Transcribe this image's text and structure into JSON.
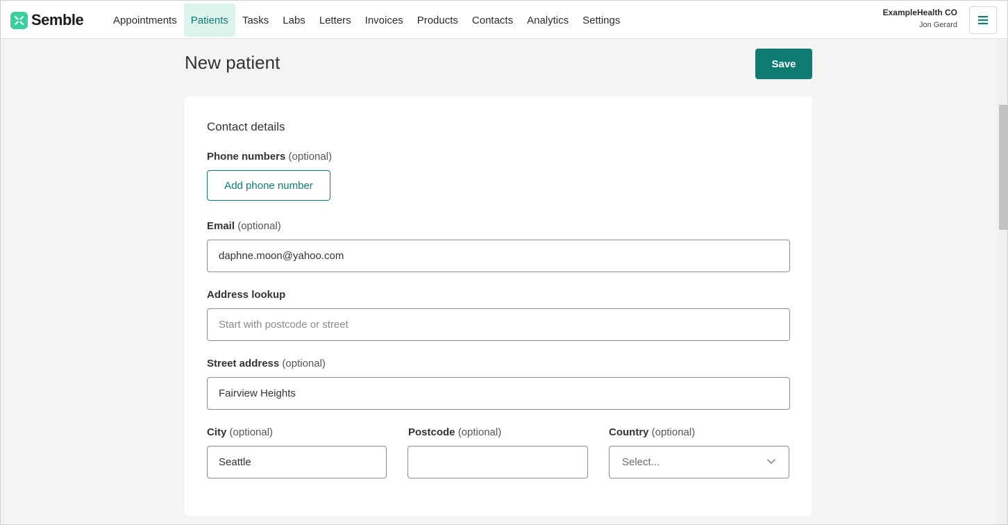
{
  "brand": {
    "name": "Semble",
    "color": "#3ccf9e",
    "accent": "#0f7a72"
  },
  "nav": {
    "items": [
      {
        "label": "Appointments",
        "active": false
      },
      {
        "label": "Patients",
        "active": true
      },
      {
        "label": "Tasks",
        "active": false
      },
      {
        "label": "Labs",
        "active": false
      },
      {
        "label": "Letters",
        "active": false
      },
      {
        "label": "Invoices",
        "active": false
      },
      {
        "label": "Products",
        "active": false
      },
      {
        "label": "Contacts",
        "active": false
      },
      {
        "label": "Analytics",
        "active": false
      },
      {
        "label": "Settings",
        "active": false
      }
    ]
  },
  "account": {
    "org": "ExampleHealth CO",
    "user": "Jon Gerard",
    "menu_icon": "hamburger-icon"
  },
  "page": {
    "title": "New patient",
    "save_label": "Save"
  },
  "contact": {
    "section_title": "Contact details",
    "phone": {
      "label": "Phone numbers",
      "optional": "(optional)",
      "add_label": "Add phone number"
    },
    "email": {
      "label": "Email",
      "optional": "(optional)",
      "value": "daphne.moon@yahoo.com"
    },
    "address_lookup": {
      "label": "Address lookup",
      "placeholder": "Start with postcode or street"
    },
    "street": {
      "label": "Street address",
      "optional": "(optional)",
      "value": "Fairview Heights"
    },
    "city": {
      "label": "City",
      "optional": "(optional)",
      "value": "Seattle"
    },
    "postcode": {
      "label": "Postcode",
      "optional": "(optional)",
      "value": ""
    },
    "country": {
      "label": "Country",
      "optional": "(optional)",
      "placeholder": "Select..."
    }
  }
}
